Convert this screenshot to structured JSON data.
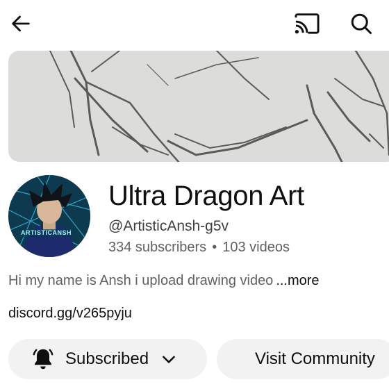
{
  "header": {
    "back_icon": "arrow-left-icon",
    "cast_icon": "cast-icon",
    "search_icon": "search-icon"
  },
  "channel": {
    "title": "Ultra Dragon Art",
    "handle": "@ArtisticAnsh-g5v",
    "subscribers": "334 subscribers",
    "separator": "•",
    "videos": "103 videos",
    "avatar_text": "ARTISTICANSH",
    "description": "Hi my name is Ansh i upload  drawing video",
    "more_label": "...more",
    "link": "discord.gg/v265pyju"
  },
  "actions": {
    "subscribed_label": "Subscribed",
    "bell_icon": "bell-icon",
    "dropdown_icon": "chevron-down-icon",
    "visit_label": "Visit Community"
  },
  "colors": {
    "background": "#ffffff",
    "text": "#0f0f0f",
    "secondary_text": "#606060",
    "pill_bg": "#f2f2f2"
  }
}
